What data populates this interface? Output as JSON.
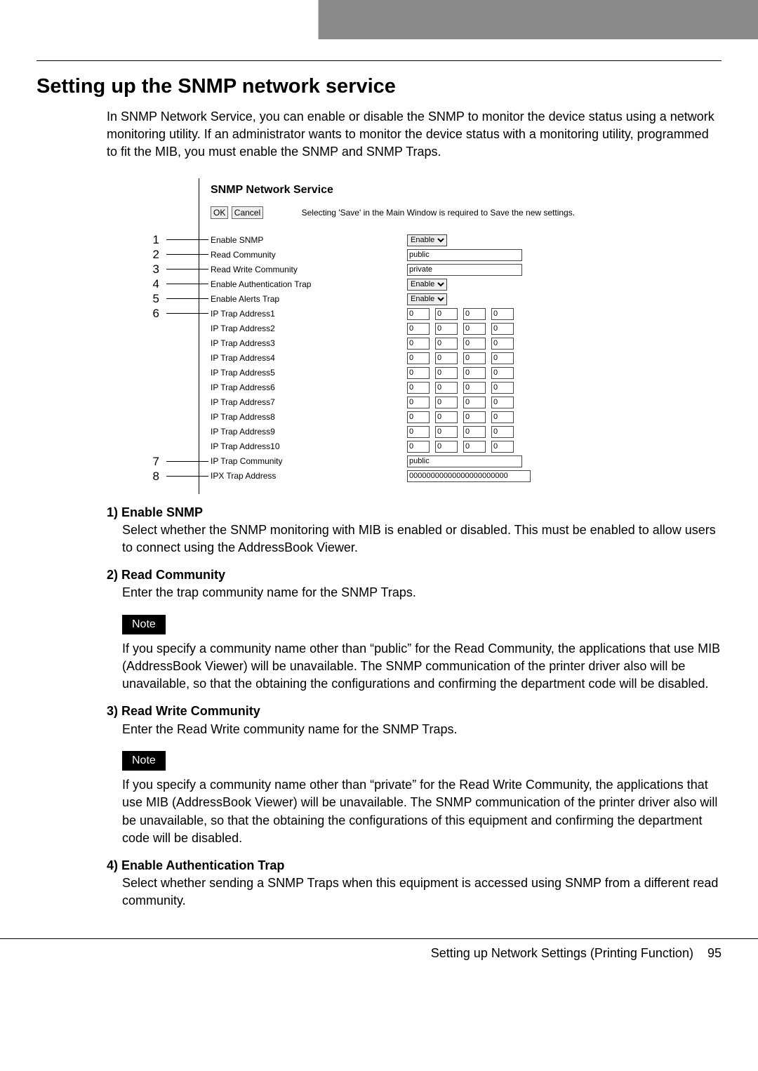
{
  "page": {
    "heading": "Setting up the SNMP network service",
    "intro": "In SNMP Network Service, you can enable or disable the SNMP to monitor the device status using a network monitoring utility.  If an administrator wants to monitor the device status with a monitoring utility, programmed to fit the MIB, you must enable the SNMP and SNMP Traps.",
    "footer_text": "Setting up Network Settings (Printing Function)",
    "footer_page": "95"
  },
  "panel": {
    "title": "SNMP Network Service",
    "ok": "OK",
    "cancel": "Cancel",
    "save_hint": "Selecting 'Save' in the Main Window is required to Save the new settings.",
    "enable_option": "Enable",
    "rows": {
      "enable_snmp": "Enable SNMP",
      "read_community": "Read Community",
      "read_community_val": "public",
      "rw_community": "Read Write Community",
      "rw_community_val": "private",
      "enable_auth": "Enable Authentication Trap",
      "enable_alerts": "Enable Alerts Trap",
      "ip_trap_prefix": "IP Trap Address",
      "ip_trap_community": "IP Trap Community",
      "ip_trap_community_val": "public",
      "ipx_trap": "IPX Trap Address",
      "ipx_trap_val": "00000000000000000000000"
    }
  },
  "callouts": [
    "1",
    "2",
    "3",
    "4",
    "5",
    "6",
    "7",
    "8"
  ],
  "descriptions": [
    {
      "num": "1)",
      "title": "Enable SNMP",
      "body": "Select whether the SNMP monitoring with MIB is enabled or disabled.  This must be enabled to allow users to connect using the AddressBook Viewer."
    },
    {
      "num": "2)",
      "title": "Read Community",
      "body": "Enter the trap community name for the SNMP Traps.",
      "note": "If you specify a community name other than “public” for the Read Community, the applications that use MIB (AddressBook Viewer) will be unavailable.  The SNMP communication of the printer driver also will be unavailable, so that the obtaining the configurations and confirming the department code will be disabled."
    },
    {
      "num": "3)",
      "title": "Read Write Community",
      "body": "Enter the Read Write community name for the SNMP Traps.",
      "note": "If you specify a community name other than “private” for the Read Write Community, the applications that use MIB (AddressBook Viewer) will be unavailable.  The SNMP communication of the printer driver also will be unavailable, so that the obtaining the configurations of this equipment and confirming the department code will be disabled."
    },
    {
      "num": "4)",
      "title": "Enable Authentication Trap",
      "body": "Select whether sending a SNMP Traps when this equipment is accessed using SNMP from a different read community."
    }
  ],
  "note_label": "Note"
}
